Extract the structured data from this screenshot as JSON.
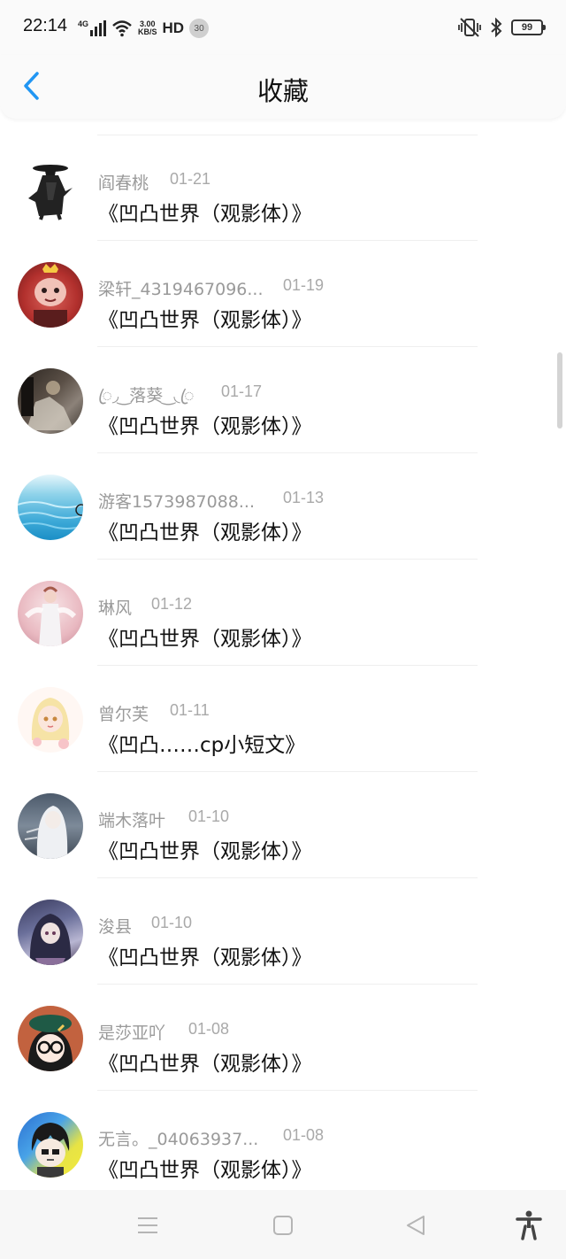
{
  "status_bar": {
    "time": "22:14",
    "network": "4G",
    "speed_value": "3.00",
    "speed_unit": "KB/S",
    "hd": "HD",
    "notification_count": "30",
    "battery": "99"
  },
  "header": {
    "title": "收藏",
    "back_icon": "chevron-left-icon",
    "accent_color": "#2196f3"
  },
  "items": [
    {
      "author": "阎春桃",
      "date": "01-21",
      "title": "《凹凸世界（观影体）》",
      "avatar": "dark-figure"
    },
    {
      "author": "梁轩_4319467096...",
      "date": "01-19",
      "title": "《凹凸世界（观影体）》",
      "avatar": "crowned-red"
    },
    {
      "author": "ꦿ◞ ͜ 落葵 ͜ ◟ꦿ",
      "date": "01-17",
      "title": "《凹凸世界（观影体）》",
      "avatar": "dark-scene"
    },
    {
      "author": "游客1573987088...",
      "date": "01-13",
      "title": "《凹凸世界（观影体）》",
      "avatar": "blue-water"
    },
    {
      "author": "琳风",
      "date": "01-12",
      "title": "《凹凸世界（观影体）》",
      "avatar": "pink-figure"
    },
    {
      "author": "曾尔芙",
      "date": "01-11",
      "title": "《凹凸……cp小短文》",
      "avatar": "blonde-girl"
    },
    {
      "author": "端木落叶",
      "date": "01-10",
      "title": "《凹凸世界（观影体）》",
      "avatar": "white-hair"
    },
    {
      "author": "浚县",
      "date": "01-10",
      "title": "《凹凸世界（观影体）》",
      "avatar": "purple-girl"
    },
    {
      "author": "是莎亚吖",
      "date": "01-08",
      "title": "《凹凸世界（观影体）》",
      "avatar": "glasses-beret"
    },
    {
      "author": "无言。_04063937...",
      "date": "01-08",
      "title": "《凹凸世界（观影体）》",
      "avatar": "chibi-boy"
    }
  ],
  "nav": {
    "menu_icon": "menu-icon",
    "home_icon": "home-square-icon",
    "back_icon": "back-triangle-icon",
    "accessibility_icon": "accessibility-icon"
  }
}
